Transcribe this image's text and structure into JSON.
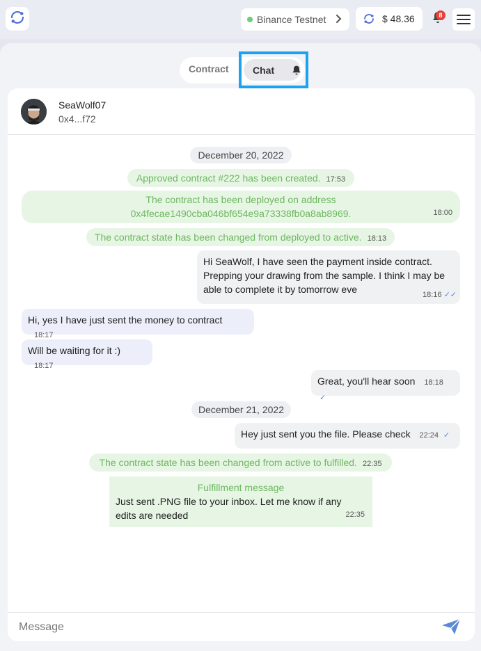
{
  "header": {
    "network": "Binance Testnet",
    "balance": "$ 48.36",
    "notifications": "8"
  },
  "tabs": {
    "contract": "Contract",
    "chat": "Chat"
  },
  "peer": {
    "name": "SeaWolf07",
    "address": "0x4...f72"
  },
  "messages": {
    "date1": "December 20, 2022",
    "sys1": {
      "text": "Approved contract #222 has been created.",
      "time": "17:53"
    },
    "sys2": {
      "line1": "The contract has been deployed on address",
      "line2": "0x4fecae1490cba046bf654e9a73338fb0a8ab8969.",
      "time": "18:00"
    },
    "sys3": {
      "text": "The contract state has been changed from deployed to active.",
      "time": "18:13"
    },
    "out1": {
      "line1": "Hi SeaWolf, I have seen the payment inside contract.",
      "line2": "Prepping your drawing from the sample. I think I may be",
      "line3": "able to complete it by tomorrow eve",
      "time": "18:16"
    },
    "in1": {
      "text": "Hi, yes I have just sent the money to contract",
      "time": "18:17"
    },
    "in2": {
      "text": "Will be waiting for it :)",
      "time": "18:17"
    },
    "out2": {
      "text": "Great, you'll hear soon",
      "time": "18:18"
    },
    "date2": "December 21, 2022",
    "out3": {
      "text": "Hey just sent you the file. Please check",
      "time": "22:24"
    },
    "sys4": {
      "text": "The contract state has been changed from active to fulfilled.",
      "time": "22:35"
    },
    "fulfill": {
      "title": "Fulfillment message",
      "line1": "Just sent .PNG file to your inbox. Let me know if any",
      "line2": "edits are needed",
      "time": "22:35"
    }
  },
  "composer": {
    "placeholder": "Message"
  },
  "colors": {
    "accent": "#5a89d6",
    "system_green": "#6db660",
    "highlight": "#1da1f2"
  }
}
